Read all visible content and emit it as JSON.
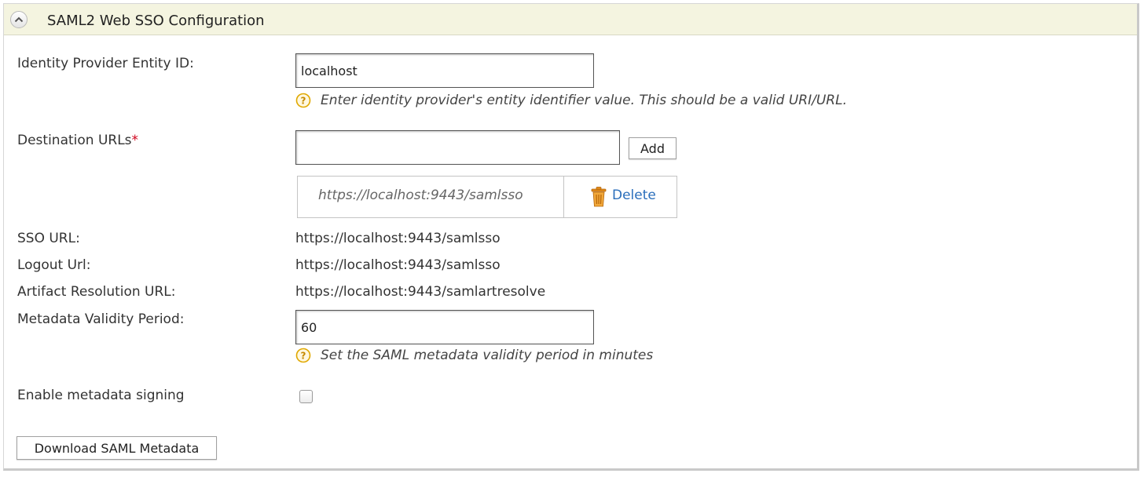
{
  "panel": {
    "title": "SAML2 Web SSO Configuration",
    "collapse_icon": "chevron-up-icon"
  },
  "idp_entity_id": {
    "label": "Identity Provider Entity ID:",
    "value": "localhost",
    "hint": "Enter identity provider's entity identifier value. This should be a valid URI/URL."
  },
  "destination_urls": {
    "label": "Destination URLs",
    "required_marker": "*",
    "input_value": "",
    "add_label": "Add",
    "entries": [
      {
        "url": "https://localhost:9443/samlsso",
        "delete_label": "Delete",
        "delete_icon": "trash-icon"
      }
    ]
  },
  "sso_url": {
    "label": "SSO URL:",
    "value": "https://localhost:9443/samlsso"
  },
  "logout_url": {
    "label": "Logout Url:",
    "value": "https://localhost:9443/samlsso"
  },
  "artifact_resolution_url": {
    "label": "Artifact Resolution URL:",
    "value": "https://localhost:9443/samlartresolve"
  },
  "metadata_validity": {
    "label": "Metadata Validity Period:",
    "value": "60",
    "hint": "Set the SAML metadata validity period in minutes"
  },
  "metadata_signing": {
    "label": "Enable metadata signing",
    "checked": false
  },
  "download_button": {
    "label": "Download SAML Metadata"
  },
  "colors": {
    "header_bg": "#f4f4e0",
    "link": "#2a6ebb",
    "required": "#d0021b",
    "help_icon": "#e0a800"
  }
}
